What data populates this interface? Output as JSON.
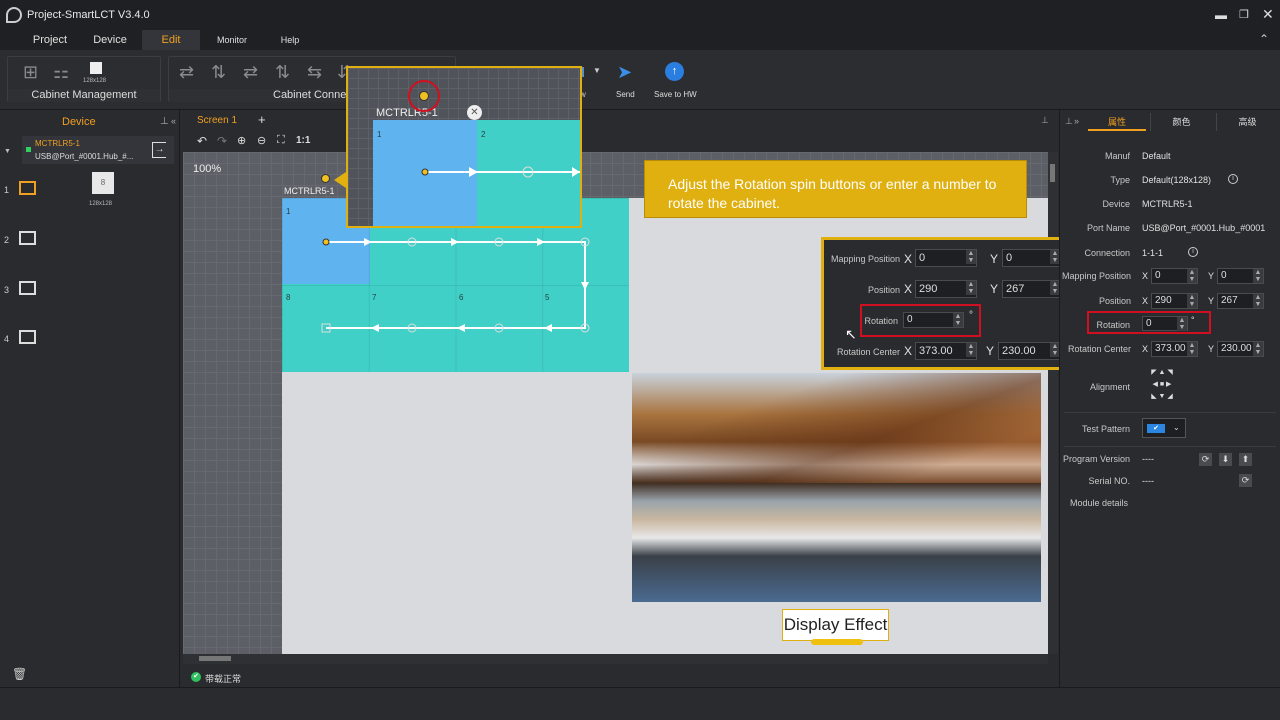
{
  "app": {
    "title": "Project-SmartLCT V3.4.0"
  },
  "menu": [
    "Project",
    "Device",
    "Edit",
    "Monitor",
    "Help"
  ],
  "ribbon": {
    "cabinet_management": "Cabinet Management",
    "cabinet_connection": "Cabinet Connecti",
    "cabinet_size": "128x128",
    "partial_label": "w",
    "send": "Send",
    "save_to_hw": "Save to HW"
  },
  "left": {
    "tab": "Device",
    "device_name": "MCTRLR5-1",
    "device_port": "USB@Port_#0001.Hub_#...",
    "thumb_num": "8",
    "thumb_size": "128x128",
    "rows": [
      "1",
      "2",
      "3",
      "4"
    ]
  },
  "screen_tab": "Screen 1",
  "zoom": "100%",
  "canvas": {
    "controller_label": "MCTRLR5-1",
    "cab_numbers": [
      "1",
      "2",
      "3",
      "4",
      "8",
      "7",
      "6",
      "5"
    ]
  },
  "callout": {
    "text": "Adjust the Rotation spin buttons or enter a number to rotate the cabinet."
  },
  "zoom_popup": {
    "label": "MCTRLR5-1",
    "n1": "1",
    "n2": "2"
  },
  "inset": {
    "mapping_position": "Mapping Position",
    "x": "X",
    "y": "Y",
    "map_x": "0",
    "map_y": "0",
    "position": "Position",
    "pos_x": "290",
    "pos_y": "267",
    "rotation": "Rotation",
    "rot": "0",
    "degree": "°",
    "rotation_center": "Rotation Center",
    "rc_x": "373.00",
    "rc_y": "230.00"
  },
  "display_effect": "Display Effect",
  "right": {
    "tabs": [
      "属性",
      "颜色",
      "高级"
    ],
    "manuf_label": "Manuf",
    "manuf": "Default",
    "type_label": "Type",
    "type": "Default(128x128)",
    "device_label": "Device",
    "device": "MCTRLR5-1",
    "port_label": "Port Name",
    "port": "USB@Port_#0001.Hub_#0001",
    "connection_label": "Connection",
    "connection": "1-1-1",
    "mapping_label": "Mapping Position",
    "map_x": "0",
    "map_y": "0",
    "position_label": "Position",
    "pos_x": "290",
    "pos_y": "267",
    "rotation_label": "Rotation",
    "rot": "0",
    "degree": "°",
    "rc_label": "Rotation Center",
    "rc_x": "373.00",
    "rc_y": "230.00",
    "x": "X",
    "y": "Y",
    "alignment_label": "Alignment",
    "test_pattern_label": "Test Pattern",
    "program_version_label": "Program Version",
    "program_version": "----",
    "serial_label": "Serial NO.",
    "serial": "----",
    "module_details": "Module details"
  },
  "status": {
    "text": "带载正常"
  },
  "colors": {
    "accent": "#f0c020",
    "cabinet": "#40d0c8",
    "cabinet_blue": "#5fb4f0",
    "highlight": "#d01020"
  }
}
